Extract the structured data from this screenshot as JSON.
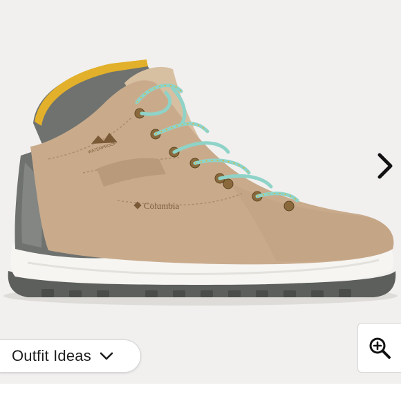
{
  "product": {
    "brand_logo": "Columbia",
    "waterproof_badge": "WATERPROOF"
  },
  "controls": {
    "outfit_ideas_label": "Outfit Ideas",
    "next_icon": "chevron-right-icon",
    "zoom_icon": "zoom-in-icon",
    "dropdown_icon": "chevron-down-icon"
  },
  "colors": {
    "background": "#f1f0ef",
    "boot_suede": "#c9ab8c",
    "boot_gray": "#6f726f",
    "laces": "#8fd3c8",
    "collar_yellow": "#e2b02a",
    "midsole": "#f6f5f2"
  }
}
